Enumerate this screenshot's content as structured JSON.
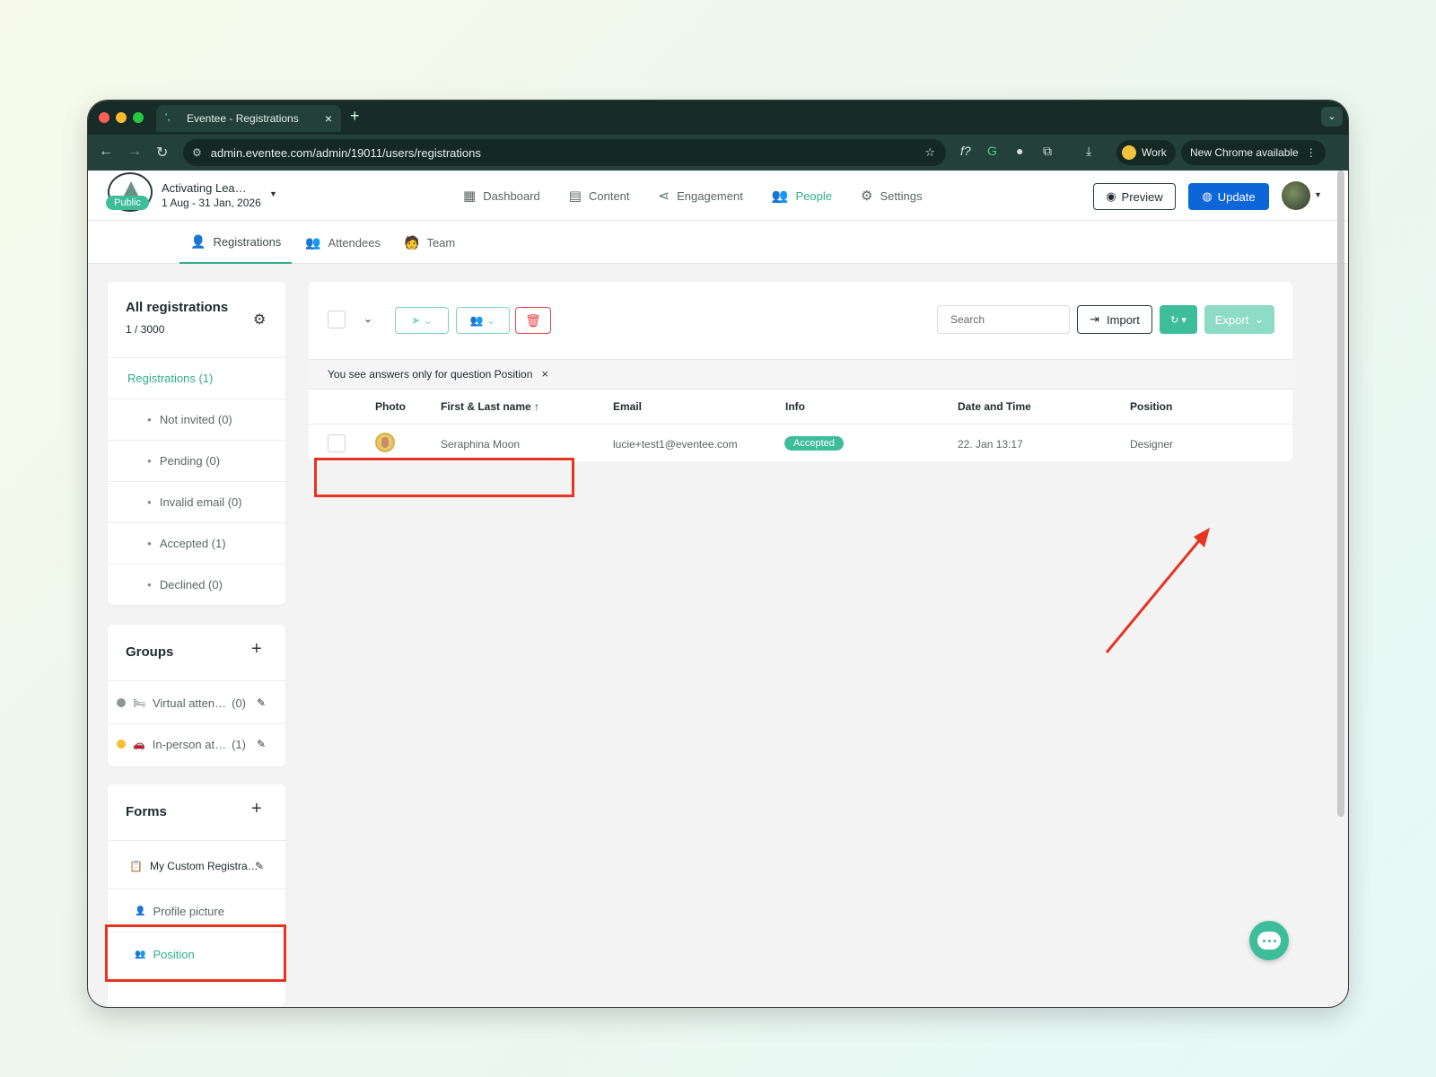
{
  "browser": {
    "tab_title": "Eventee - Registrations",
    "url": "admin.eventee.com/admin/19011/users/registrations",
    "profile_label": "Work",
    "update_notice": "New Chrome available"
  },
  "event": {
    "status_badge": "Public",
    "name": "Activating Lea…",
    "dates": "1 Aug - 31 Jan, 2026"
  },
  "main_nav": [
    {
      "label": "Dashboard",
      "icon": "dashboard-icon"
    },
    {
      "label": "Content",
      "icon": "calendar-icon"
    },
    {
      "label": "Engagement",
      "icon": "share-icon"
    },
    {
      "label": "People",
      "icon": "people-icon",
      "active": true
    },
    {
      "label": "Settings",
      "icon": "gear-icon"
    }
  ],
  "header_actions": {
    "preview": "Preview",
    "update": "Update"
  },
  "sub_nav": [
    {
      "label": "Registrations",
      "active": true
    },
    {
      "label": "Attendees"
    },
    {
      "label": "Team"
    }
  ],
  "registrations_card": {
    "title": "All registrations",
    "count": "1 / 3000",
    "top_item": "Registrations (1)",
    "items": [
      "Not invited (0)",
      "Pending (0)",
      "Invalid email (0)",
      "Accepted (1)",
      "Declined (0)"
    ]
  },
  "groups_card": {
    "title": "Groups",
    "items": [
      {
        "label": "Virtual atten…",
        "count": "(0)",
        "dot_color": "#8a9894",
        "icon": "bed-icon"
      },
      {
        "label": "In-person at…",
        "count": "(1)",
        "dot_color": "#f2c12e",
        "icon": "car-icon"
      }
    ]
  },
  "forms_card": {
    "title": "Forms",
    "form_name": "My Custom Registra…",
    "fields": [
      "Profile picture",
      "Position"
    ],
    "active_field": "Position"
  },
  "toolbar": {
    "search_placeholder": "Search",
    "import_label": "Import",
    "export_label": "Export"
  },
  "filter_note": "You see answers only for question Position",
  "table": {
    "headers": [
      "Photo",
      "First & Last name ↑",
      "Email",
      "Info",
      "Date and Time",
      "Position"
    ],
    "rows": [
      {
        "name": "Seraphina Moon",
        "email": "lucie+test1@eventee.com",
        "info": "Accepted",
        "datetime": "22. Jan 13:17",
        "position": "Designer"
      }
    ]
  },
  "colors": {
    "accent": "#2fae8b",
    "accent_button": "#3dbd9a",
    "update_button": "#0d66d8",
    "delete": "#e8414b",
    "highlight_box": "#e5341f"
  }
}
